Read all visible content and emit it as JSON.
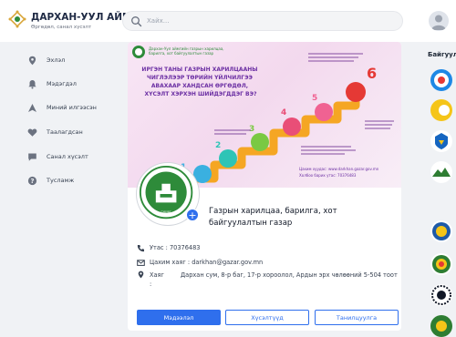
{
  "brand": {
    "title": "ДАРХАН-УУЛ АЙМАГ",
    "subtitle": "Өргөдөл, санал хүсэлт",
    "logo": "darkhan-uul-emblem"
  },
  "search": {
    "placeholder": "Хайх..."
  },
  "sidebar": {
    "items": [
      {
        "label": "Эхлэл",
        "icon": "location-pin-icon"
      },
      {
        "label": "Мэдэгдэл",
        "icon": "bell-icon"
      },
      {
        "label": "Миний илгээсэн",
        "icon": "send-icon"
      },
      {
        "label": "Таалагдсан",
        "icon": "heart-icon"
      },
      {
        "label": "Санал хүсэлт",
        "icon": "chat-icon"
      },
      {
        "label": "Тусламж",
        "icon": "help-icon"
      }
    ]
  },
  "banner": {
    "header": "Дархан-Уул аймгийн газрын харилцаа, барилга, хот байгуулалтын газар",
    "question": "ИРГЭН ТАНЫ ГАЗРЫН ХАРИЛЦААНЫ ЧИГЛЭЛЭЭР ТӨРИЙН ҮЙЛЧИЛГЭЭ АВАХААР ХАНДСАН ӨРГӨДӨЛ, ХҮСЭЛТ ХЭРХЭН ШИЙДЭГДДЭГ ВЭ?",
    "steps": [
      "1",
      "2",
      "3",
      "4",
      "5",
      "6"
    ],
    "website": "Цахим хуудас: www.darkhan.gazar.gov.mn",
    "phone": "Холбоо барих утас: 70376483"
  },
  "organization": {
    "name": "Газрын харилцаа, барилга, хот байгуулалтын газар",
    "phone_label": "Утас : 70376483",
    "email_label": "Цахим хаяг : darkhan@gazar.gov.mn",
    "address_label": "Хаяг",
    "address_sep": ":",
    "address_value": "Дархан сум, 8-р баг, 17-р хороолол, Ардын эрх чөлөөний 5-504 тоот"
  },
  "buttons": {
    "primary": "Мэдээлэл",
    "secondary": "Хүсэлтүүд",
    "tertiary": "Танилцуулга"
  },
  "right_panel": {
    "title": "Байгууллага",
    "logos": [
      "org-logo-1",
      "org-logo-2",
      "org-logo-3",
      "org-logo-4",
      "org-logo-5",
      "org-logo-6",
      "org-logo-7"
    ]
  },
  "colors": {
    "accent": "#2f6fed",
    "brand_green": "#2e8b3a",
    "banner_pink": "#f3d9ee",
    "question_purple": "#6b2fa3"
  }
}
